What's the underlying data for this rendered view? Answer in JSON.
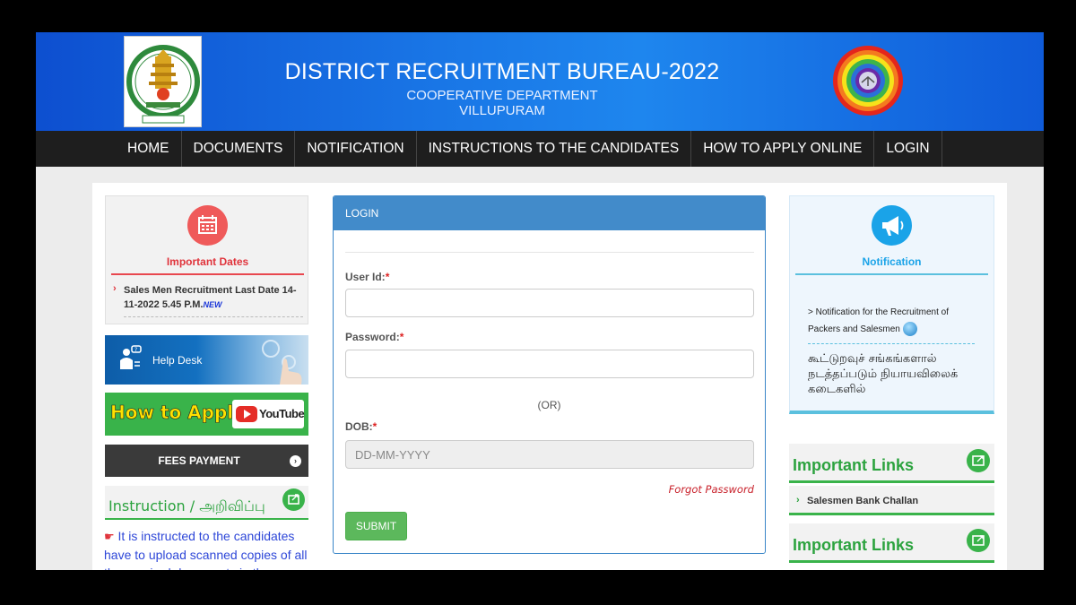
{
  "header": {
    "title": "DISTRICT RECRUITMENT BUREAU-2022",
    "department": "COOPERATIVE DEPARTMENT",
    "district": "VILLUPURAM",
    "emblem_icon": "tamil-nadu-emblem",
    "coop_logo_icon": "cooperative-rainbow-logo",
    "gradient_colors": [
      "#0d4fd0",
      "#1e86ee"
    ]
  },
  "nav": {
    "items": [
      {
        "label": "HOME"
      },
      {
        "label": "DOCUMENTS"
      },
      {
        "label": "NOTIFICATION"
      },
      {
        "label": "INSTRUCTIONS TO THE CANDIDATES"
      },
      {
        "label": "HOW TO APPLY ONLINE"
      },
      {
        "label": "LOGIN"
      }
    ]
  },
  "important_dates": {
    "title": "Important Dates",
    "icon": "calendar-icon",
    "item": "Sales Men Recruitment Last Date 14-11-2022 5.45 P.M.",
    "badge": "NEW",
    "accent": "#ef5a5a"
  },
  "help_desk": {
    "label": "Help Desk",
    "icon": "help-desk-person-icon"
  },
  "how_to_apply": {
    "label": "How to Apply",
    "youtube_label": "YouTube"
  },
  "fees_payment": {
    "label": "FEES PAYMENT",
    "icon": "arrow-circle-right-icon"
  },
  "instruction": {
    "title": "Instruction / அறிவிப்பு",
    "icon": "pointing-hand-icon",
    "text": "It is instructed to the candidates have to upload scanned copies of all the required documents in the"
  },
  "login": {
    "title": "LOGIN",
    "userid_label": "User Id:",
    "password_label": "Password:",
    "or_text": "(OR)",
    "dob_label": "DOB:",
    "dob_placeholder": "DD-MM-YYYY",
    "required_mark": "*",
    "forgot_password": "Forgot Password",
    "submit_label": "SUBMIT",
    "header_color": "#428bca",
    "submit_color": "#5cb85c"
  },
  "notification": {
    "title": "Notification",
    "icon": "megaphone-icon",
    "item": "> Notification for the Recruitment of Packers and Salesmen",
    "tamil_text": "கூட்டுறவுச் சங்கங்களால் நடத்தப்படும் நியாயவிலைக் கடைகளில்",
    "accent": "#1aa3e8"
  },
  "important_links": {
    "title_1": "Important Links",
    "item_1": "Salesmen Bank Challan",
    "title_2": "Important Links",
    "accent": "#39b34a"
  }
}
